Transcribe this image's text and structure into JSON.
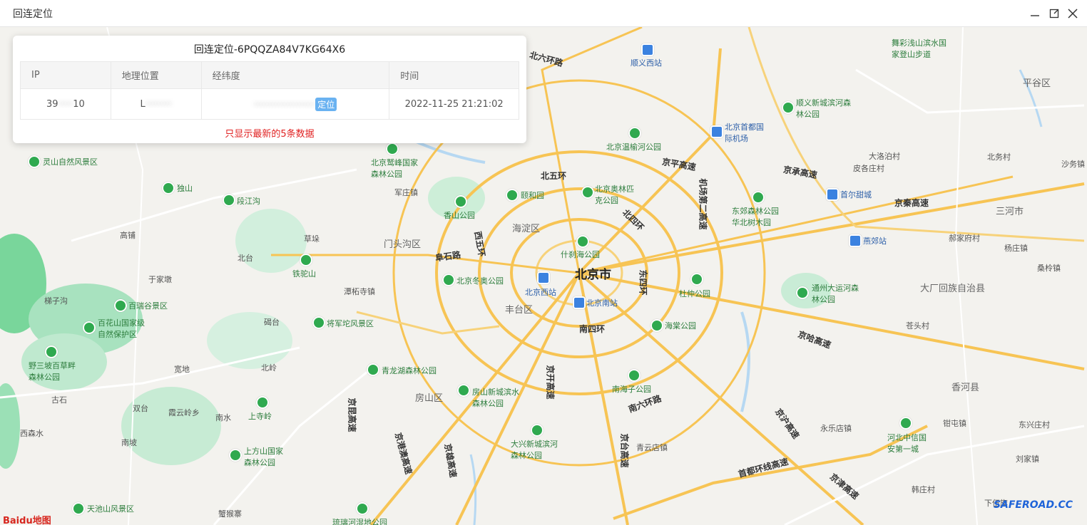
{
  "window": {
    "title": "回连定位",
    "controls": [
      "minimize-icon",
      "maximize-icon",
      "close-icon"
    ]
  },
  "panel": {
    "title": "回连定位-6PQQZA84V7KG64X6",
    "columns": [
      "IP",
      "地理位置",
      "经纬度",
      "时间"
    ],
    "rows": [
      {
        "ip_start": "39",
        "ip_end": "10",
        "ip_masked": "·····",
        "location_start": "L",
        "location_masked": "·········",
        "coords_masked": "·····················",
        "locate_label": "定位",
        "time": "2022-11-25 21:21:02"
      }
    ],
    "note": "只显示最新的5条数据"
  },
  "map": {
    "city": "北京市",
    "districts": [
      "海淀区",
      "门头沟区",
      "丰台区",
      "房山区",
      "平谷区",
      "三河市",
      "香河县",
      "大厂回族自治县"
    ],
    "roads": [
      "北六环路",
      "北五环",
      "北四环",
      "西五环",
      "东四环",
      "南四环",
      "京平高速",
      "机场第二高速",
      "京承高速",
      "京秦高速",
      "京哈高速",
      "南六环路",
      "京开高速",
      "京台高速",
      "首都环线高速",
      "阜石路",
      "京昆高速",
      "京港澳高速",
      "京雄高速",
      "京津高速",
      "京沪高速"
    ],
    "pois": [
      "顺义西站",
      "北京首都国际机场",
      "北京温榆河公园",
      "顺义新城滨河森林公园",
      "舞彩浅山滨水国家登山步道",
      "颐和园",
      "北京奥林匹克公园",
      "香山公园",
      "什刹海公园",
      "北京西站",
      "北京南站",
      "北京冬奥公园",
      "杜仲公园",
      "海棠公园",
      "东郊森林公园华北树木园",
      "通州大运河森林公园",
      "南海子公园",
      "大兴新城滨河森林公园",
      "房山新城滨水森林公园",
      "青龙湖森林公园",
      "将军坨风景区",
      "铁驼山",
      "百瑞谷景区",
      "百花山国家级自然保护区",
      "野三坡百草畔森林公园",
      "上方山国家森林公园",
      "天池山风景区",
      "灵山自然风景区",
      "北京鹫峰国家森林公园",
      "首尔甜城",
      "燕郊站",
      "河北中信国安第一城",
      "上寺岭",
      "独山",
      "段江沟",
      "琉璃河湿地公园"
    ],
    "towns": [
      "军庄镇",
      "潭柘寺镇",
      "于家墩",
      "梯子沟",
      "北台",
      "北岭",
      "碣台",
      "古石",
      "双台",
      "西森水",
      "南坡",
      "霞云岭乡",
      "南水",
      "宽地",
      "蟹猴寨",
      "高铺",
      "草垛",
      "皮各庄村",
      "大洛泊村",
      "北务村",
      "郝家府村",
      "杨庄镇",
      "桑柃镇",
      "苍头村",
      "永乐店镇",
      "钳屯镇",
      "东兴庄村",
      "刘家镇",
      "韩庄村",
      "下伍旗",
      "青云店镇",
      "沙务镇"
    ],
    "attribution": "Baidu地图",
    "watermark": "SAFEROAD.CC"
  },
  "colors": {
    "accent": "#6ab2f1",
    "note": "#e02020",
    "park": "#5fcf8b",
    "highway": "#f7c454"
  }
}
